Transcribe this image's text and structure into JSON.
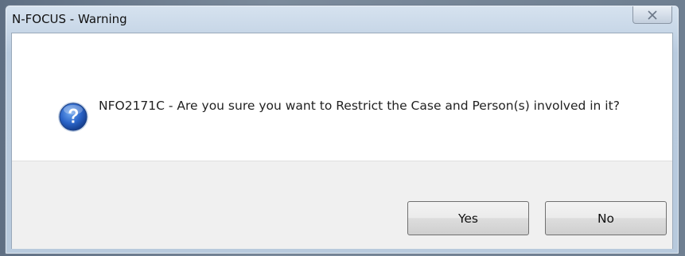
{
  "window": {
    "title": "N-FOCUS - Warning"
  },
  "dialog": {
    "icon": "question-icon",
    "message": "NFO2171C - Are you sure you want to Restrict the Case and Person(s) involved in it?"
  },
  "buttons": {
    "yes_label": "Yes",
    "no_label": "No"
  },
  "colors": {
    "accent": "#1f5fbf",
    "dialog_bg": "#ffffff",
    "button_bar_bg": "#f0f0f0"
  }
}
